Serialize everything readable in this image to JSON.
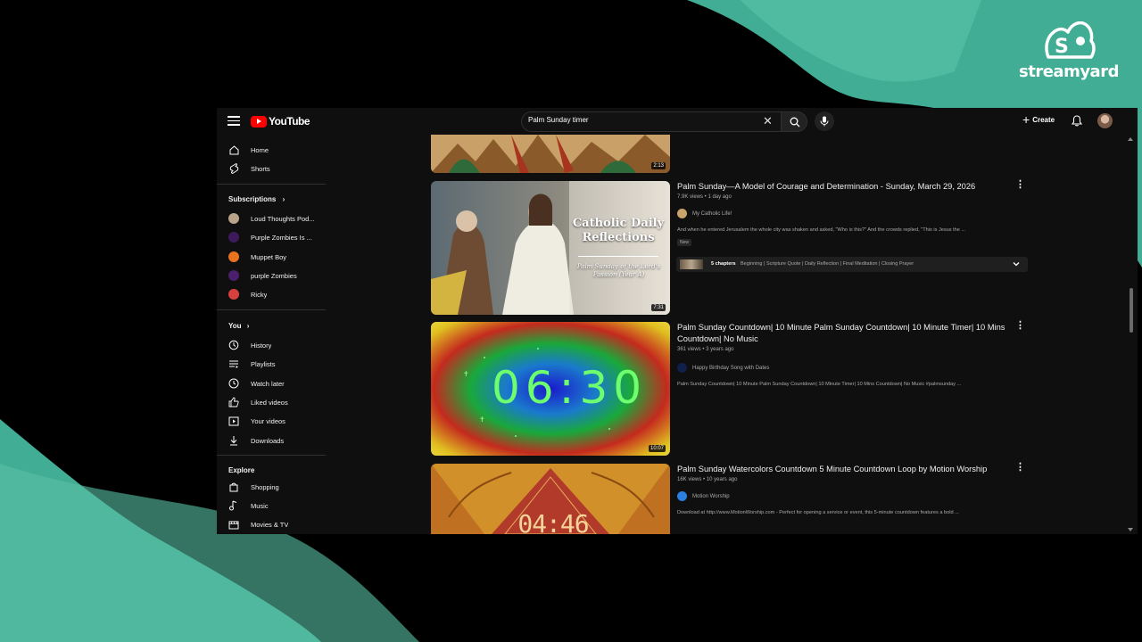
{
  "brand": {
    "name": "streamyard"
  },
  "topbar": {
    "logo_text": "YouTube",
    "search": {
      "value": "Palm Sunday timer"
    },
    "create_label": "Create"
  },
  "sidebar": {
    "primary": [
      {
        "label": "Home",
        "icon": "home-icon"
      },
      {
        "label": "Shorts",
        "icon": "shorts-icon"
      }
    ],
    "subscriptions_header": "Subscriptions",
    "subscriptions": [
      {
        "label": "Loud Thoughts Pod...",
        "color": "#b9a48a"
      },
      {
        "label": "Purple Zombies Is ...",
        "color": "#3d1a5c"
      },
      {
        "label": "Muppet Boy",
        "color": "#e8731f"
      },
      {
        "label": "purple Zombies",
        "color": "#4a1f6b"
      },
      {
        "label": "Ricky",
        "color": "#d84040"
      }
    ],
    "you_header": "You",
    "you": [
      {
        "label": "History",
        "icon": "history-icon"
      },
      {
        "label": "Playlists",
        "icon": "playlists-icon"
      },
      {
        "label": "Watch later",
        "icon": "watch-later-icon"
      },
      {
        "label": "Liked videos",
        "icon": "like-icon"
      },
      {
        "label": "Your videos",
        "icon": "your-videos-icon"
      },
      {
        "label": "Downloads",
        "icon": "download-icon"
      }
    ],
    "explore_header": "Explore",
    "explore": [
      {
        "label": "Shopping",
        "icon": "shopping-icon"
      },
      {
        "label": "Music",
        "icon": "music-icon"
      },
      {
        "label": "Movies & TV",
        "icon": "movies-icon"
      }
    ]
  },
  "results": {
    "top_partial": {
      "duration": "2:13"
    },
    "videos": [
      {
        "title": "Palm Sunday—A Model of Courage and Determination - Sunday, March 29, 2026",
        "meta": "7.9K views • 1 day ago",
        "channel": "My Catholic Life!",
        "description": "And when he entered Jerusalem the whole city was shaken and asked, \"Who is this?\" And the crowds replied, \"This is Jesus the ...",
        "badge": "New",
        "duration": "7:31",
        "thumb_title": "Catholic Daily Reflections",
        "thumb_subtitle": "Palm Sunday of the Lord's Passion (Year A)",
        "chapters_count": "5 chapters",
        "chapters_list": "Beginning | Scripture Quote | Daily Reflection | Final Meditation | Closing Prayer"
      },
      {
        "title": "Palm Sunday Countdown| 10 Minute Palm Sunday Countdown| 10 Minute Timer| 10 Mins Countdown| No Music",
        "meta": "361 views • 3 years ago",
        "channel": "Happy Birthday Song with Dates",
        "description": "Palm Sunday Countdown| 10 Minute Palm Sunday Countdown| 10 Minute Timer| 10 Mins Countdown| No Music #palmsunday ...",
        "duration": "10:07",
        "thumb_time": "06:30"
      },
      {
        "title": "Palm Sunday Watercolors Countdown 5 Minute Countdown Loop by Motion Worship",
        "meta": "16K views • 10 years ago",
        "channel": "Motion Worship",
        "description": "Download at http://www.MotionWorship.com - Perfect for opening a service or event, this 5-minute countdown features a bold ...",
        "thumb_time": "04:46"
      }
    ]
  }
}
